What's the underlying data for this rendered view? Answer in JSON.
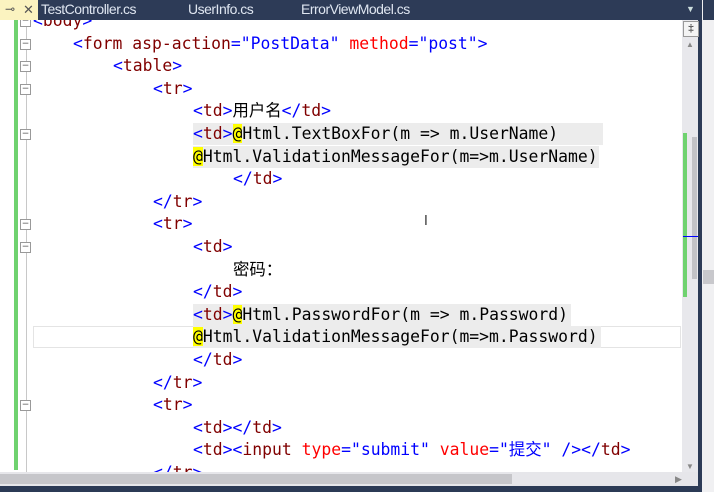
{
  "tabs": [
    {
      "label": "TestController.cs"
    },
    {
      "label": "UserInfo.cs"
    },
    {
      "label": "ErrorViewModel.cs"
    }
  ],
  "icons": {
    "pin": "pin-icon",
    "close": "close-icon",
    "dropdown": "chevron-down-icon",
    "split": "split-icon"
  },
  "colors": {
    "tag": "#800000",
    "bracket": "#0000ff",
    "attribute": "#ff0000",
    "value": "#0000ff",
    "razor_highlight": "#ffff00",
    "changed_margin": "#6fd26f",
    "tab_bar": "#2d3b57"
  },
  "code": [
    [
      [
        "br",
        "<"
      ],
      [
        "tag",
        "body"
      ],
      [
        "br",
        ">"
      ]
    ],
    [
      [
        "br",
        "<"
      ],
      [
        "tag",
        "form"
      ],
      [
        "txt",
        " "
      ],
      [
        "tag",
        "asp-action"
      ],
      [
        "br",
        "="
      ],
      [
        "val",
        "\"PostData\""
      ],
      [
        "txt",
        " "
      ],
      [
        "attr",
        "method"
      ],
      [
        "br",
        "="
      ],
      [
        "val",
        "\"post\""
      ],
      [
        "br",
        ">"
      ]
    ],
    [
      [
        "br",
        "<"
      ],
      [
        "tag",
        "table"
      ],
      [
        "br",
        ">"
      ]
    ],
    [
      [
        "br",
        "<"
      ],
      [
        "tag",
        "tr"
      ],
      [
        "br",
        ">"
      ]
    ],
    [
      [
        "br",
        "<"
      ],
      [
        "tag",
        "td"
      ],
      [
        "br",
        ">"
      ],
      [
        "txt",
        "用户名"
      ],
      [
        "br",
        "</"
      ],
      [
        "tag",
        "td"
      ],
      [
        "br",
        ">"
      ]
    ],
    [
      [
        "br",
        "<"
      ],
      [
        "tag",
        "td"
      ],
      [
        "br",
        ">"
      ],
      [
        "at",
        "@"
      ],
      [
        "code",
        "Html.TextBoxFor(m => m.UserName)"
      ]
    ],
    [
      [
        "at",
        "@"
      ],
      [
        "code",
        "Html.ValidationMessageFor(m=>m.UserName)"
      ]
    ],
    [
      [
        "br",
        "</"
      ],
      [
        "tag",
        "td"
      ],
      [
        "br",
        ">"
      ]
    ],
    [
      [
        "br",
        "</"
      ],
      [
        "tag",
        "tr"
      ],
      [
        "br",
        ">"
      ]
    ],
    [
      [
        "br",
        "<"
      ],
      [
        "tag",
        "tr"
      ],
      [
        "br",
        ">"
      ]
    ],
    [
      [
        "br",
        "<"
      ],
      [
        "tag",
        "td"
      ],
      [
        "br",
        ">"
      ]
    ],
    [
      [
        "txt",
        "密码："
      ]
    ],
    [
      [
        "br",
        "</"
      ],
      [
        "tag",
        "td"
      ],
      [
        "br",
        ">"
      ]
    ],
    [
      [
        "br",
        "<"
      ],
      [
        "tag",
        "td"
      ],
      [
        "br",
        ">"
      ],
      [
        "at",
        "@"
      ],
      [
        "code",
        "Html.PasswordFor(m => m.Password)"
      ]
    ],
    [
      [
        "at",
        "@"
      ],
      [
        "code",
        "Html.ValidationMessageFor(m=>m.Password)"
      ]
    ],
    [
      [
        "br",
        "</"
      ],
      [
        "tag",
        "td"
      ],
      [
        "br",
        ">"
      ]
    ],
    [
      [
        "br",
        "</"
      ],
      [
        "tag",
        "tr"
      ],
      [
        "br",
        ">"
      ]
    ],
    [
      [
        "br",
        "<"
      ],
      [
        "tag",
        "tr"
      ],
      [
        "br",
        ">"
      ]
    ],
    [
      [
        "br",
        "<"
      ],
      [
        "tag",
        "td"
      ],
      [
        "br",
        "></"
      ],
      [
        "tag",
        "td"
      ],
      [
        "br",
        ">"
      ]
    ],
    [
      [
        "br",
        "<"
      ],
      [
        "tag",
        "td"
      ],
      [
        "br",
        "><"
      ],
      [
        "tag",
        "input"
      ],
      [
        "txt",
        " "
      ],
      [
        "attr",
        "type"
      ],
      [
        "br",
        "="
      ],
      [
        "val",
        "\"submit\""
      ],
      [
        "txt",
        " "
      ],
      [
        "attr",
        "value"
      ],
      [
        "br",
        "="
      ],
      [
        "val",
        "\"提交\""
      ],
      [
        "txt",
        " "
      ],
      [
        "br",
        "/></"
      ],
      [
        "tag",
        "td"
      ],
      [
        "br",
        ">"
      ]
    ],
    [
      [
        "br",
        "</"
      ],
      [
        "tag",
        "tr"
      ],
      [
        "br",
        ">"
      ]
    ]
  ]
}
